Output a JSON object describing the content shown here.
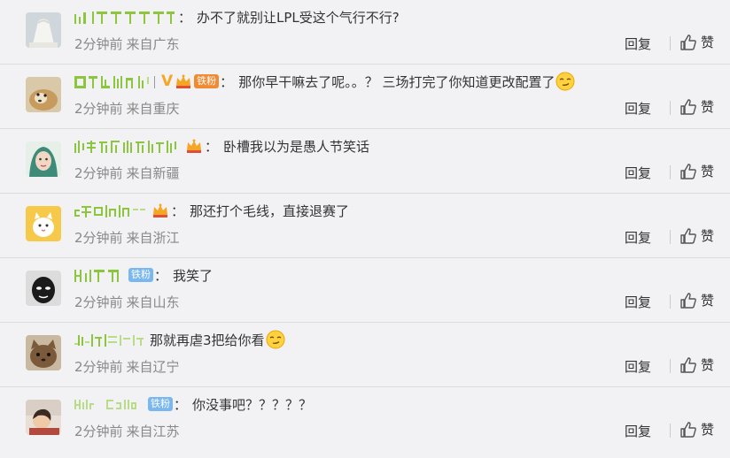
{
  "colors": {
    "background": "#f2f2f5",
    "divider": "#dcdcdc",
    "meta_text": "#888888",
    "orange_badge": "#f08b33",
    "blue_badge": "#7ab7ee",
    "username_green": "#8cc63f"
  },
  "actions": {
    "reply_label": "回复",
    "like_label": "赞"
  },
  "comments": [
    {
      "colon": "：",
      "text": "办不了就别让LPL受这个气行不行?",
      "time": "2分钟前",
      "source": "来自广东",
      "avatar": "hat-avatar",
      "has_vip": false,
      "has_crown": false,
      "badge": null
    },
    {
      "colon": "：",
      "text": "那你早干嘛去了呢。。？ 三场打完了你知道更改配置了",
      "time": "2分钟前",
      "source": "来自重庆",
      "vip_mark": "V",
      "badge": "铁粉",
      "emoji": "smirk-face-icon"
    },
    {
      "colon": "：",
      "text": "卧槽我以为是愚人节笑话",
      "time": "2分钟前",
      "source": "来自新疆"
    },
    {
      "colon": "：",
      "text": "那还打个毛线，直接退赛了",
      "time": "2分钟前",
      "source": "来自浙江"
    },
    {
      "colon": "：",
      "text": "我笑了",
      "time": "2分钟前",
      "source": "来自山东",
      "badge": "铁粉"
    },
    {
      "colon": "：",
      "text": "那就再虐3把给你看",
      "time": "2分钟前",
      "source": "来自辽宁",
      "emoji": "smirk-face-icon"
    },
    {
      "colon": "：",
      "text": "你没事吧？？？？？",
      "time": "2分钟前",
      "source": "来自江苏",
      "badge": "铁粉"
    }
  ]
}
